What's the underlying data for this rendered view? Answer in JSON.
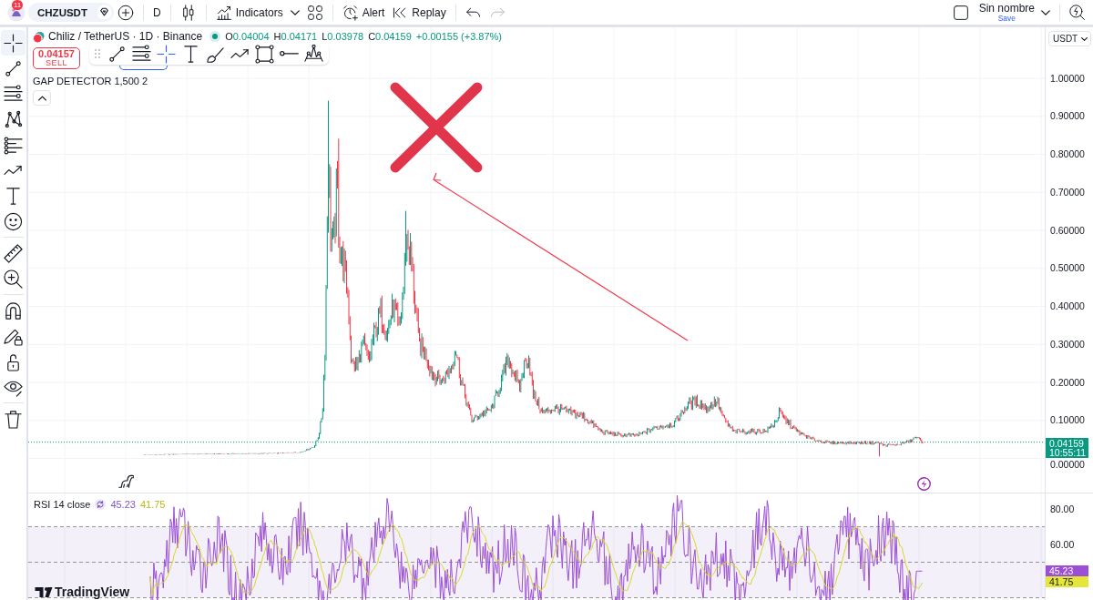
{
  "top_bar": {
    "notification_count": "11",
    "symbol": "CHZUSDT",
    "interval": "D",
    "indicators": "Indicators",
    "alert": "Alert",
    "replay": "Replay",
    "undo": {
      "disabled": false
    },
    "redo": {
      "disabled": true
    },
    "layout_name": "Sin nombre",
    "save": "Save"
  },
  "left_toolbar": {
    "groups": [
      [
        {
          "kind": "crosshair",
          "selected": true
        },
        {
          "kind": "trend-line",
          "selected": false
        },
        {
          "kind": "fib",
          "selected": false
        },
        {
          "kind": "pattern",
          "selected": false
        },
        {
          "kind": "forecast",
          "selected": false
        },
        {
          "kind": "path",
          "selected": false
        },
        {
          "kind": "text",
          "selected": false
        },
        {
          "kind": "emoji",
          "selected": false
        }
      ],
      [
        {
          "kind": "ruler",
          "selected": false
        },
        {
          "kind": "zoom",
          "selected": false
        }
      ],
      [
        {
          "kind": "magnet",
          "selected": false
        },
        {
          "kind": "lock-drawing",
          "selected": false
        },
        {
          "kind": "lock",
          "selected": false
        },
        {
          "kind": "eye",
          "selected": false
        }
      ],
      [
        {
          "kind": "trash",
          "selected": false
        }
      ]
    ]
  },
  "chart": {
    "title": "Chiliz / TetherUS · 1D · Binance",
    "ohlc": [
      {
        "label": "O",
        "value": "0.04004"
      },
      {
        "label": "H",
        "value": "0.04171"
      },
      {
        "label": "L",
        "value": "0.03978"
      },
      {
        "label": "C",
        "value": "0.04159"
      }
    ],
    "change": "+0.00155 (+3.87%)",
    "sell_button": {
      "price": "0.04157",
      "label": "SELL"
    },
    "drawing_toolbar": {
      "items": [
        {
          "kind": "trend-line",
          "selected": false
        },
        {
          "kind": "fib",
          "selected": false
        },
        {
          "kind": "crosshair",
          "selected": true
        },
        {
          "kind": "text",
          "selected": false
        },
        {
          "kind": "brush",
          "selected": false
        },
        {
          "kind": "path",
          "selected": false
        },
        {
          "kind": "rectangle",
          "selected": false
        },
        {
          "kind": "ray",
          "selected": false
        },
        {
          "kind": "peaks",
          "selected": false
        }
      ]
    },
    "indicator": "GAP DETECTOR 1,500 2",
    "currency": "USDT",
    "price_axis": [
      "1.00000",
      "0.90000",
      "0.80000",
      "0.70000",
      "0.60000",
      "0.50000",
      "0.40000",
      "0.30000",
      "0.20000",
      "0.10000",
      "0.00000"
    ],
    "last_price": {
      "value": "0.04159",
      "countdown": "10:55:11"
    }
  },
  "rsi": {
    "title": "RSI 14 close",
    "value": "45.23",
    "average": "41.75",
    "axis": [
      "80.00",
      "60.00"
    ],
    "value_badge": "45.23",
    "average_badge": "41.75"
  },
  "brand": "TradingView"
}
